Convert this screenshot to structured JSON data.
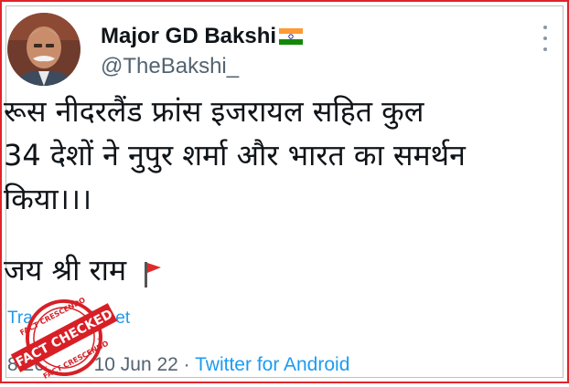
{
  "author": {
    "display_name": "Major GD Bakshi",
    "handle": "@TheBakshi_",
    "flag_icon": "indian-flag-icon"
  },
  "tweet": {
    "lines": [
      "रूस नीदरलैंड फ्रांस इजरायल सहित कुल",
      "34 देशों ने नुपुर शर्मा और भारत का समर्थन",
      "किया।।।",
      "जय श्री राम"
    ],
    "trailing_icon": "red-flag-icon"
  },
  "translate_label": "Translate Tweet",
  "meta": {
    "time": "8:26 pm",
    "separator": "·",
    "date": "10 Jun 22",
    "source": "Twitter for Android"
  },
  "stamp": {
    "top_text": "FACT CRESCENDO",
    "main_text": "FACT CHECKED",
    "bottom_text": "FACT CRESCENDO"
  },
  "colors": {
    "frame": "#e0242b",
    "stamp": "#d81f26",
    "link": "#1d9bf0",
    "secondary_text": "#536471"
  }
}
